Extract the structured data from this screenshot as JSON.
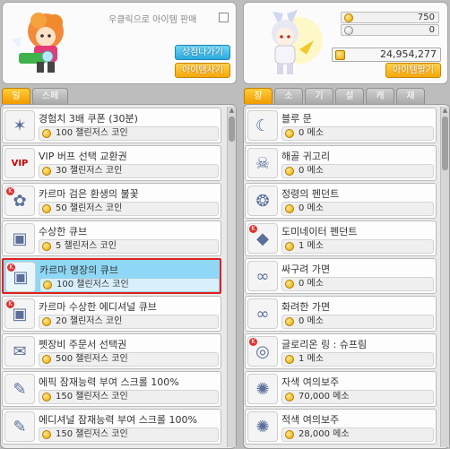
{
  "left_header": {
    "sell_label": "우클릭으로 아이템 판매",
    "go_shop_button": "상점나가기",
    "buy_item_button": "아이템사기"
  },
  "left_tabs": [
    {
      "label": "일반",
      "active": true
    },
    {
      "label": "스페셜",
      "active": false
    }
  ],
  "shop_items": [
    {
      "name": "경험치 3배 쿠폰 (30분)",
      "price": "100 챌린저스 코인",
      "icon": "exp-coupon-icon",
      "glyph": "✶",
      "badge": false
    },
    {
      "name": "VIP 버프 선택 교환권",
      "price": "30 챌린저스 코인",
      "icon": "vip-ticket-icon",
      "glyph": "VIP",
      "badge": false
    },
    {
      "name": "카르마 검은 환생의 불꽃",
      "price": "50 챌린저스 코인",
      "icon": "black-flame-icon",
      "glyph": "✿",
      "badge": true
    },
    {
      "name": "수상한 큐브",
      "price": "5 챌린저스 코인",
      "icon": "suspicious-cube-icon",
      "glyph": "▣",
      "badge": false
    },
    {
      "name": "카르마 명장의 큐브",
      "price": "100 챌린저스 코인",
      "icon": "master-cube-icon",
      "glyph": "▣",
      "badge": true,
      "selected": true
    },
    {
      "name": "카르마 수상한 에디셔널 큐브",
      "price": "20 챌린저스 코인",
      "icon": "additional-cube-icon",
      "glyph": "▣",
      "badge": true
    },
    {
      "name": "펫장비 주문서 선택권",
      "price": "500 챌린저스 코인",
      "icon": "pet-scroll-ticket-icon",
      "glyph": "✉",
      "badge": false
    },
    {
      "name": "에픽 잠재능력 부여 스크롤 100%",
      "price": "150 챌린저스 코인",
      "icon": "epic-scroll-icon",
      "glyph": "✎",
      "badge": false
    },
    {
      "name": "에디셔널 잠재능력 부여 스크롤 100%",
      "price": "150 챌린저스 코인",
      "icon": "additional-scroll-icon",
      "glyph": "✎",
      "badge": false
    }
  ],
  "right_header": {
    "stat1": "750",
    "stat2": "0",
    "meso": "24,954,277",
    "sell_item_button": "아이템팔기"
  },
  "right_tabs": [
    {
      "label": "장비",
      "active": true
    },
    {
      "label": "소비",
      "active": false
    },
    {
      "label": "기타",
      "active": false
    },
    {
      "label": "설치",
      "active": false
    },
    {
      "label": "캐시",
      "active": false
    },
    {
      "label": "재장",
      "active": false
    }
  ],
  "inventory_items": [
    {
      "name": "블루 문",
      "price": "0 메소",
      "icon": "blue-moon-icon",
      "glyph": "☾",
      "badge": false
    },
    {
      "name": "해골 귀고리",
      "price": "0 메소",
      "icon": "skull-earring-icon",
      "glyph": "☠",
      "badge": false
    },
    {
      "name": "정령의 펜던트",
      "price": "0 메소",
      "icon": "spirit-pendant-icon",
      "glyph": "❂",
      "badge": false
    },
    {
      "name": "도미네이터 펜던트",
      "price": "1 메소",
      "icon": "dominator-pendant-icon",
      "glyph": "◆",
      "badge": true
    },
    {
      "name": "싸구려 가면",
      "price": "0 메소",
      "icon": "cheap-mask-icon",
      "glyph": "∞",
      "badge": false
    },
    {
      "name": "화려한 가면",
      "price": "0 메소",
      "icon": "fancy-mask-icon",
      "glyph": "∞",
      "badge": false
    },
    {
      "name": "글로리온 링 : 슈프림",
      "price": "1 메소",
      "icon": "glorion-ring-icon",
      "glyph": "◎",
      "badge": true
    },
    {
      "name": "자색 여의보주",
      "price": "70,000 메소",
      "icon": "purple-orb-icon",
      "glyph": "✺",
      "badge": false
    },
    {
      "name": "적색 여의보주",
      "price": "28,000 메소",
      "icon": "red-orb-icon",
      "glyph": "✺",
      "badge": false
    }
  ]
}
